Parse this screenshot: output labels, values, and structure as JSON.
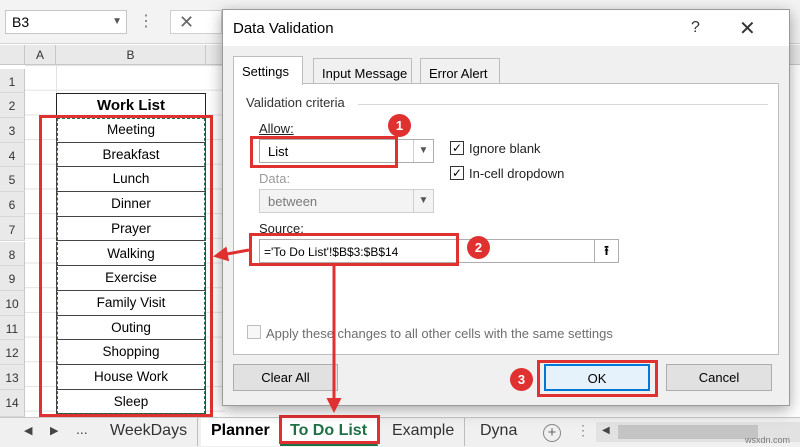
{
  "formula_bar": {
    "name_box": "B3",
    "dots": "⋮",
    "cancel_glyph": "✕"
  },
  "grid": {
    "column_headers": [
      "A",
      "B"
    ],
    "row_numbers": [
      "1",
      "2",
      "3",
      "4",
      "5",
      "6",
      "7",
      "8",
      "9",
      "10",
      "11",
      "12",
      "13",
      "14"
    ],
    "header_cell": "Work List",
    "items": [
      "Meeting",
      "Breakfast",
      "Lunch",
      "Dinner",
      "Prayer",
      "Walking",
      "Exercise",
      "Family Visit",
      "Outing",
      "Shopping",
      "House Work",
      "Sleep"
    ]
  },
  "sheet_tabs": {
    "nav_prev": "◀",
    "nav_next": "▶",
    "more": "...",
    "tabs": [
      "WeekDays",
      "Planner",
      "To Do List",
      "Example",
      "Dyna"
    ],
    "add_glyph": "+",
    "divider": "⋮"
  },
  "dialog": {
    "title": "Data Validation",
    "help": "?",
    "close": "✕",
    "tabs": [
      "Settings",
      "Input Message",
      "Error Alert"
    ],
    "group_label": "Validation criteria",
    "allow_label": "Allow:",
    "allow_value": "List",
    "ignore_blank_label": "Ignore blank",
    "in_cell_dropdown_label": "In-cell dropdown",
    "data_label": "Data:",
    "data_value": "between",
    "source_label": "Source:",
    "source_value": "='To Do List'!$B$3:$B$14",
    "source_btn": "⭱",
    "apply_all_label": "Apply these changes to all other cells with the same settings",
    "clear_all": "Clear All",
    "ok": "OK",
    "cancel": "Cancel"
  },
  "annotations": {
    "steps": [
      "1",
      "2",
      "3"
    ],
    "accent_color": "#e03131"
  },
  "watermark": "wsxdn.com"
}
